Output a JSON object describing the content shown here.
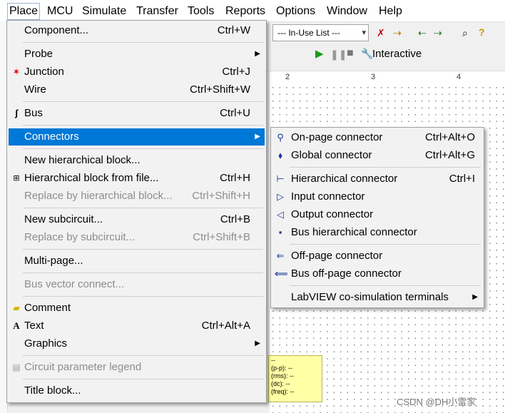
{
  "menubar": {
    "items": [
      "Place",
      "MCU",
      "Simulate",
      "Transfer",
      "Tools",
      "Reports",
      "Options",
      "Window",
      "Help"
    ]
  },
  "toolbar": {
    "inuse_list": "--- In-Use List ---",
    "interactive": "Interactive"
  },
  "ruler": {
    "ticks": [
      "2",
      "3",
      "4"
    ]
  },
  "probe": {
    "lines": [
      "(p-p): --",
      "(rms): --",
      "(dc): --",
      "(freq): --"
    ]
  },
  "watermark": "CSDN @DH小雷家",
  "place_menu": {
    "items": [
      {
        "label": "Component...",
        "shortcut": "Ctrl+W"
      },
      {
        "label": "Probe"
      },
      {
        "label": "Junction",
        "shortcut": "Ctrl+J"
      },
      {
        "label": "Wire",
        "shortcut": "Ctrl+Shift+W"
      },
      {
        "label": "Bus",
        "shortcut": "Ctrl+U"
      },
      {
        "label": "Connectors"
      },
      {
        "label": "New hierarchical block..."
      },
      {
        "label": "Hierarchical block from file...",
        "shortcut": "Ctrl+H"
      },
      {
        "label": "Replace by hierarchical block...",
        "shortcut": "Ctrl+Shift+H"
      },
      {
        "label": "New subcircuit...",
        "shortcut": "Ctrl+B"
      },
      {
        "label": "Replace by subcircuit...",
        "shortcut": "Ctrl+Shift+B"
      },
      {
        "label": "Multi-page..."
      },
      {
        "label": "Bus vector connect..."
      },
      {
        "label": "Comment"
      },
      {
        "label": "Text",
        "shortcut": "Ctrl+Alt+A"
      },
      {
        "label": "Graphics"
      },
      {
        "label": "Circuit parameter legend"
      },
      {
        "label": "Title block..."
      }
    ]
  },
  "connectors_menu": {
    "items": [
      {
        "label": "On-page connector",
        "shortcut": "Ctrl+Alt+O"
      },
      {
        "label": "Global connector",
        "shortcut": "Ctrl+Alt+G"
      },
      {
        "label": "Hierarchical connector",
        "shortcut": "Ctrl+I"
      },
      {
        "label": "Input connector"
      },
      {
        "label": "Output connector"
      },
      {
        "label": "Bus hierarchical connector"
      },
      {
        "label": "Off-page connector"
      },
      {
        "label": "Bus off-page connector"
      },
      {
        "label": "LabVIEW co-simulation terminals"
      }
    ]
  },
  "colors": {
    "highlight": "#0078d7",
    "disabled": "#8d8d8d"
  }
}
